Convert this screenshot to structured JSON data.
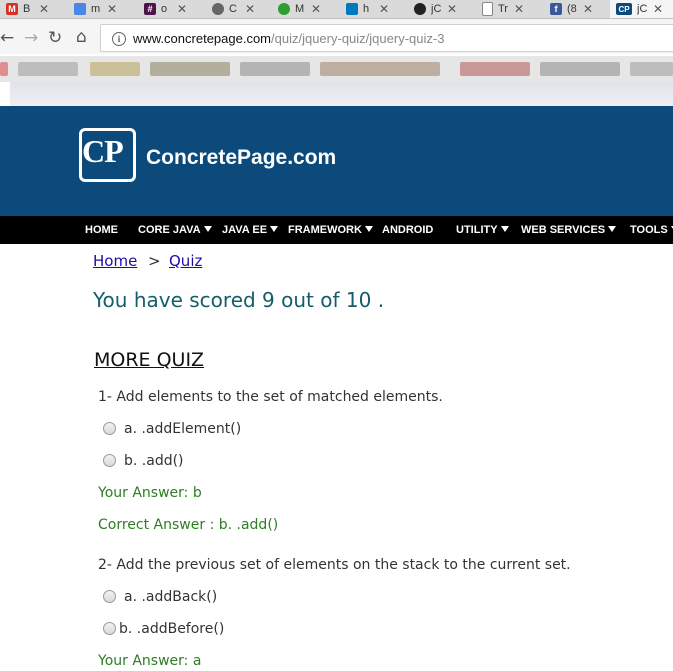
{
  "browser": {
    "tabs": [
      {
        "icon": "gmail-icon",
        "letter": "M",
        "label": "B",
        "color": "#d93025"
      },
      {
        "icon": "docs-icon",
        "letter": "",
        "label": "m",
        "color": "#4a86e8"
      },
      {
        "icon": "hash-icon",
        "letter": "#",
        "label": "o",
        "color": "#4a154b"
      },
      {
        "icon": "codepen-icon",
        "letter": "",
        "label": "C",
        "color": "#666666"
      },
      {
        "icon": "green-circle-icon",
        "letter": "",
        "label": "M",
        "color": "#2e9e2e"
      },
      {
        "icon": "trello-icon",
        "letter": "",
        "label": "h",
        "color": "#0079bf"
      },
      {
        "icon": "github-icon",
        "letter": "",
        "label": "jC",
        "color": "#222222"
      },
      {
        "icon": "page-icon",
        "letter": "",
        "label": "Tr",
        "color": "#888888"
      },
      {
        "icon": "facebook-icon",
        "letter": "f",
        "label": "(8",
        "color": "#3b5998"
      },
      {
        "icon": "cp-icon",
        "letter": "CP",
        "label": "jC",
        "color": "#0b4a7b"
      }
    ],
    "url_domain": "www.concretepage.com",
    "url_path": "/quiz/jquery-quiz/jquery-quiz-3"
  },
  "site": {
    "logo_text": "CP",
    "name": "ConcretePage.com",
    "nav": [
      {
        "label": "HOME",
        "dropdown": false
      },
      {
        "label": "CORE JAVA",
        "dropdown": true
      },
      {
        "label": "JAVA EE",
        "dropdown": true
      },
      {
        "label": "FRAMEWORK",
        "dropdown": true
      },
      {
        "label": "ANDROID",
        "dropdown": false
      },
      {
        "label": "UTILITY",
        "dropdown": true
      },
      {
        "label": "WEB SERVICES",
        "dropdown": true
      },
      {
        "label": "TOOLS",
        "dropdown": true
      }
    ]
  },
  "breadcrumb": {
    "home": "Home",
    "sep": ">",
    "quiz": "Quiz"
  },
  "score_text": "You have scored 9 out of 10 .",
  "more_quiz": "MORE QUIZ",
  "questions": [
    {
      "text": "1- Add elements to the set of matched elements.",
      "options": [
        "a. .addElement()",
        "b. .add()"
      ],
      "your_answer": "Your Answer: b",
      "correct_answer": "Correct Answer : b. .add()"
    },
    {
      "text": "2- Add the previous set of elements on the stack to the current set.",
      "options": [
        "a. .addBack()",
        "b. .addBefore()"
      ],
      "your_answer": "Your Answer: a"
    }
  ]
}
